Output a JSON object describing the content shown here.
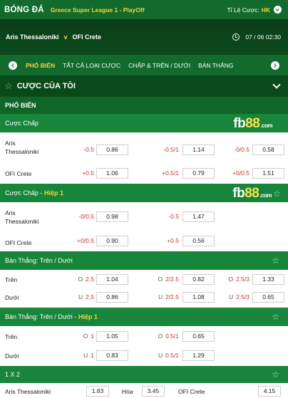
{
  "header": {
    "brand": "BÓNG ĐÁ",
    "league": "Greece Super League 1 - PlayOff",
    "odds_label": "Tỉ Lệ Cược:",
    "odds_value": "HK"
  },
  "match": {
    "home": "Aris Thessaloniki",
    "vs": "v",
    "away": "OFI Crete",
    "datetime": "07 / 06  02:30"
  },
  "tabs": [
    {
      "label": "PHỔ BIẾN",
      "active": true
    },
    {
      "label": "TẤT CẢ LOẠI CƯỢC"
    },
    {
      "label": "CHẤP & TRÊN / DƯỚI"
    },
    {
      "label": "BÀN THẮNG"
    }
  ],
  "my_bets": {
    "title": "CƯỢC CỦA TÔI"
  },
  "popular": {
    "title": "PHỔ BIẾN"
  },
  "logo": {
    "fb": "fb",
    "num": "88",
    "com": ".com"
  },
  "sections": [
    {
      "title": "Cược Chấp",
      "highlight": "",
      "rows": [
        {
          "team": "Aris\nThessaloniki",
          "cells": [
            {
              "line": "-0.5",
              "odd": "0.86"
            },
            {
              "line": "-0.5/1",
              "odd": "1.14"
            },
            {
              "line": "-0/0.5",
              "odd": "0.58"
            }
          ]
        },
        {
          "team": "OFI Crete",
          "cells": [
            {
              "line": "+0.5",
              "odd": "1.06"
            },
            {
              "line": "+0.5/1",
              "odd": "0.79"
            },
            {
              "line": "+0/0.5",
              "odd": "1.51"
            }
          ]
        }
      ]
    },
    {
      "title": "Cược Chấp - ",
      "highlight": "Hiệp 1",
      "rows": [
        {
          "team": "Aris\nThessaloniki",
          "cells": [
            {
              "line": "-0/0.5",
              "odd": "0.98"
            },
            {
              "line": "-0.5",
              "odd": "1.47"
            }
          ]
        },
        {
          "team": "OFI Crete",
          "cells": [
            {
              "line": "+0/0.5",
              "odd": "0.90"
            },
            {
              "line": "+0.5",
              "odd": "0.56"
            }
          ]
        }
      ]
    },
    {
      "title": "Bàn Thắng: Trên / Dưới",
      "highlight": "",
      "rows": [
        {
          "team": "Trên",
          "cells": [
            {
              "pre": "O",
              "line": "2.5",
              "odd": "1.04"
            },
            {
              "pre": "O",
              "line": "2/2.5",
              "odd": "0.82"
            },
            {
              "pre": "O",
              "line": "2.5/3",
              "odd": "1.33"
            }
          ]
        },
        {
          "team": "Dưới",
          "cells": [
            {
              "pre": "U",
              "line": "2.5",
              "odd": "0.86"
            },
            {
              "pre": "U",
              "line": "2/2.5",
              "odd": "1.08"
            },
            {
              "pre": "U",
              "line": "2.5/3",
              "odd": "0.65"
            }
          ]
        }
      ]
    },
    {
      "title": "Bàn Thắng: Trên / Dưới - ",
      "highlight": "Hiệp 1",
      "rows": [
        {
          "team": "Trên",
          "cells": [
            {
              "pre": "O",
              "line": "1",
              "odd": "1.05"
            },
            {
              "pre": "O",
              "line": "0.5/1",
              "odd": "0.65"
            }
          ]
        },
        {
          "team": "Dưới",
          "cells": [
            {
              "pre": "U",
              "line": "1",
              "odd": "0.83"
            },
            {
              "pre": "U",
              "line": "0.5/1",
              "odd": "1.29"
            }
          ]
        }
      ]
    }
  ],
  "x12": {
    "title": "1 X 2",
    "home": "Aris Thessaloniki",
    "home_odd": "1.83",
    "draw": "Hòa",
    "draw_odd": "3.45",
    "away": "OFI Crete",
    "away_odd": "4.15"
  }
}
